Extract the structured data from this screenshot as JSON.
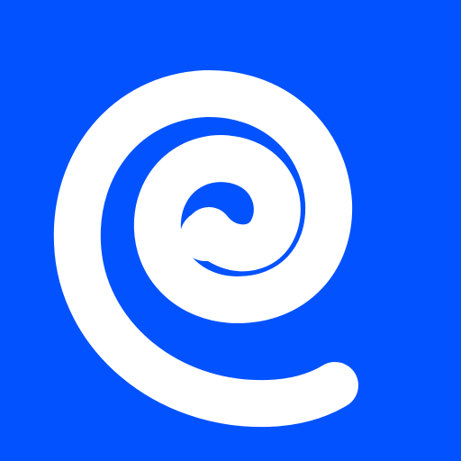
{
  "logo": {
    "icon": "spiral-icon",
    "background_color": "#0352FF",
    "mark_color": "#FFFFFF"
  }
}
